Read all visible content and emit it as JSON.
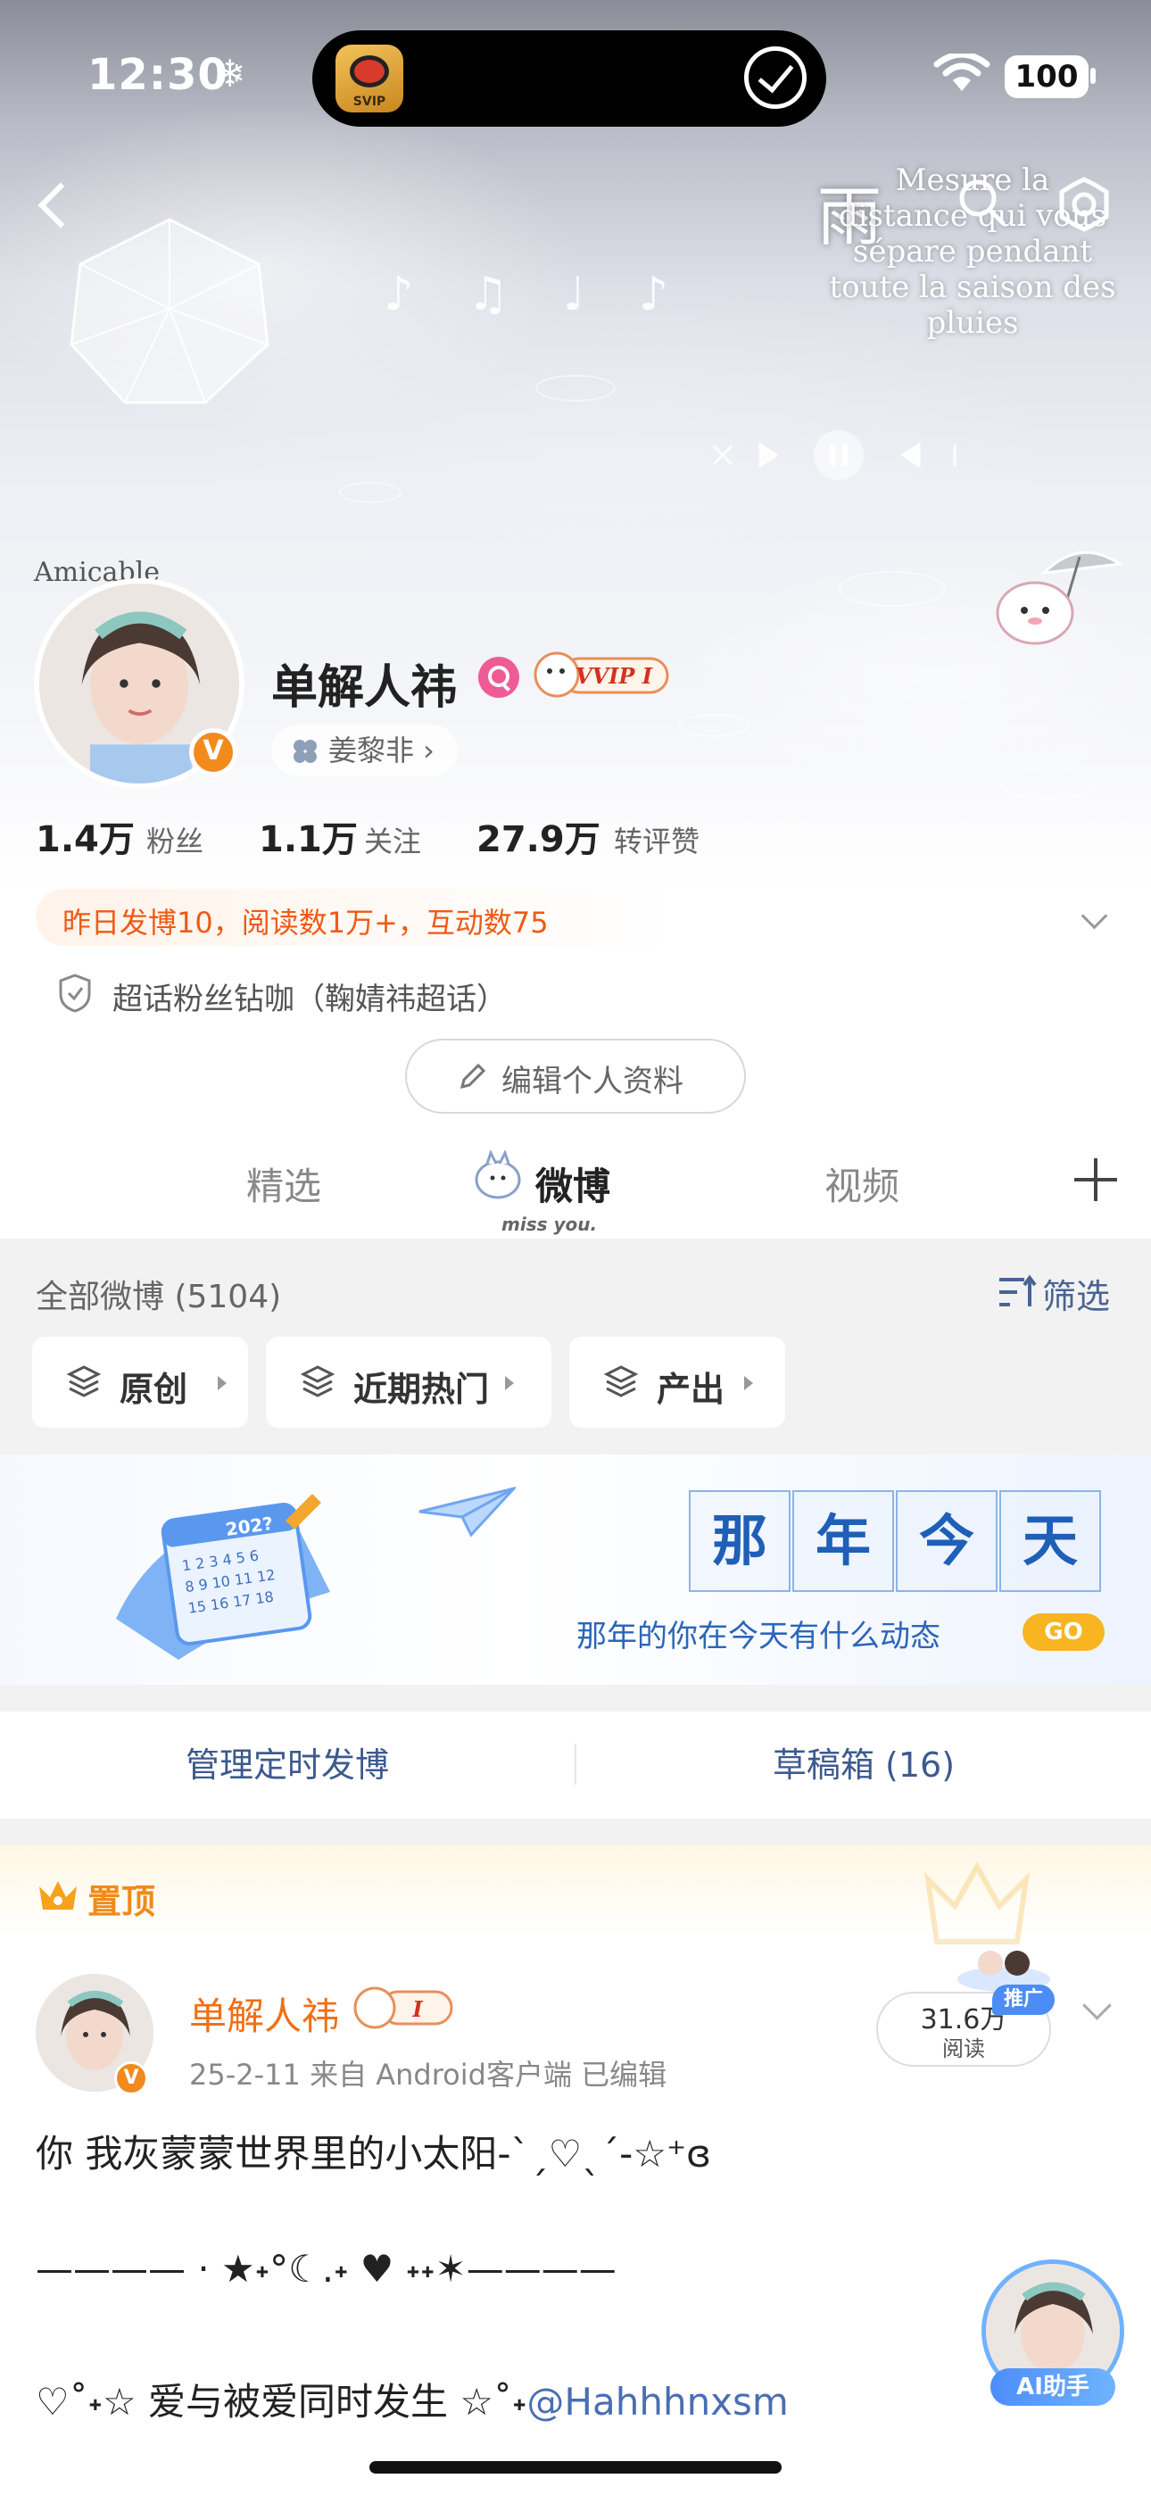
{
  "status_bar": {
    "time": "12:30",
    "battery": "100"
  },
  "dynamic_island": {
    "app_badge": "SVIP"
  },
  "hero": {
    "rain_char": "雨",
    "lyrics": [
      "Mesure la",
      "distance qui vous",
      "sépare pendant",
      "toute la saison des",
      "pluies"
    ]
  },
  "profile": {
    "avatar_caption": "Amicable",
    "verified_mark": "V",
    "username": "单解人祎",
    "vip_badge": "VVIP I",
    "fan_group": "姜黎非 ›",
    "stats": [
      {
        "value": "1.4万",
        "label": "粉丝"
      },
      {
        "value": "1.1万",
        "label": "关注"
      },
      {
        "value": "27.9万",
        "label": "转评赞"
      }
    ],
    "activity": "昨日发博10，阅读数1万+，互动数75",
    "chaohua": "超话粉丝钻咖（鞠婧祎超话）",
    "edit_button": "编辑个人资料"
  },
  "tabs": {
    "items": [
      "精选",
      "微博",
      "视频"
    ],
    "active": "微博",
    "mascot_caption": "miss you."
  },
  "feed": {
    "count_label": "全部微博 (5104)",
    "filter_label": "筛选",
    "chips": [
      "原创",
      "近期热门",
      "产出"
    ]
  },
  "memory_banner": {
    "chars": [
      "那",
      "年",
      "今",
      "天"
    ],
    "subtitle": "那年的你在今天有什么动态",
    "go": "GO",
    "calendar_year": "202?"
  },
  "tools": {
    "schedule": "管理定时发博",
    "drafts": "草稿箱 (16)"
  },
  "pinned_post": {
    "pinned_label": "置顶",
    "author": "单解人祎",
    "author_badge": "I",
    "meta": "25-2-11  来自 Android客户端  已编辑",
    "read_count": "31.6万",
    "read_label": "阅读",
    "promo": "推广",
    "lines": [
      "你 我灰蒙蒙世界里的小太阳-`ˏ♡ˎ´-☆⁺ɞ",
      "———— · ★˖°☾.˖ ♥ ˖˖✶————",
      "♡˚˖☆ 爱与被爱同时发生    ☆˚˖"
    ],
    "mention": "@Hahhhnxsm"
  },
  "ai_assistant": {
    "label": "AI助手"
  },
  "colors": {
    "accent_orange": "#f05a14",
    "link_blue": "#4a6eb3",
    "banner_blue": "#1f5fb8",
    "go_yellow": "#f8b521"
  }
}
